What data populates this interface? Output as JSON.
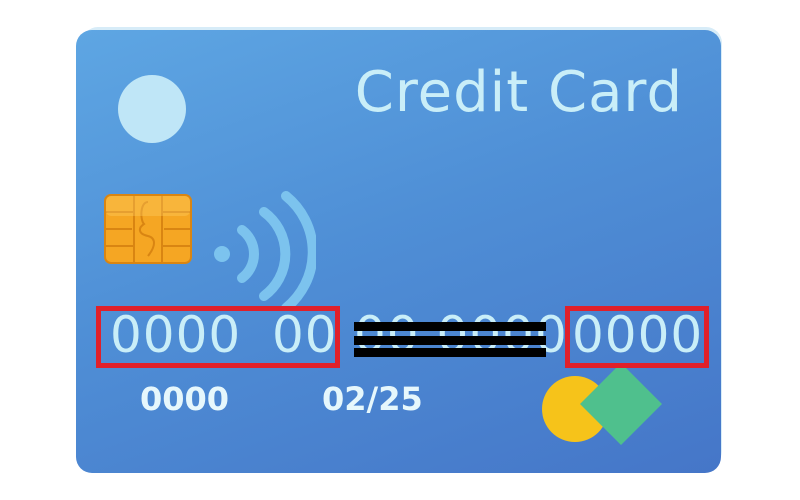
{
  "card": {
    "title": "Credit Card",
    "number_group_1": "0000",
    "number_group_2": "00",
    "number_hidden": "00 0000",
    "number_group_4": "0000",
    "code": "0000",
    "expiry": "02/25"
  },
  "colors": {
    "card_top": "#5ea6e3",
    "card_bottom": "#4576c8",
    "text": "#c9eef8",
    "chip": "#f5a623",
    "highlight_box": "#e0202a",
    "redaction": "#000000",
    "logo_circle": "#f6c31a",
    "logo_diamond": "#4fc08d"
  },
  "icons": [
    "chip-icon",
    "contactless-icon",
    "card-brand-logo"
  ]
}
